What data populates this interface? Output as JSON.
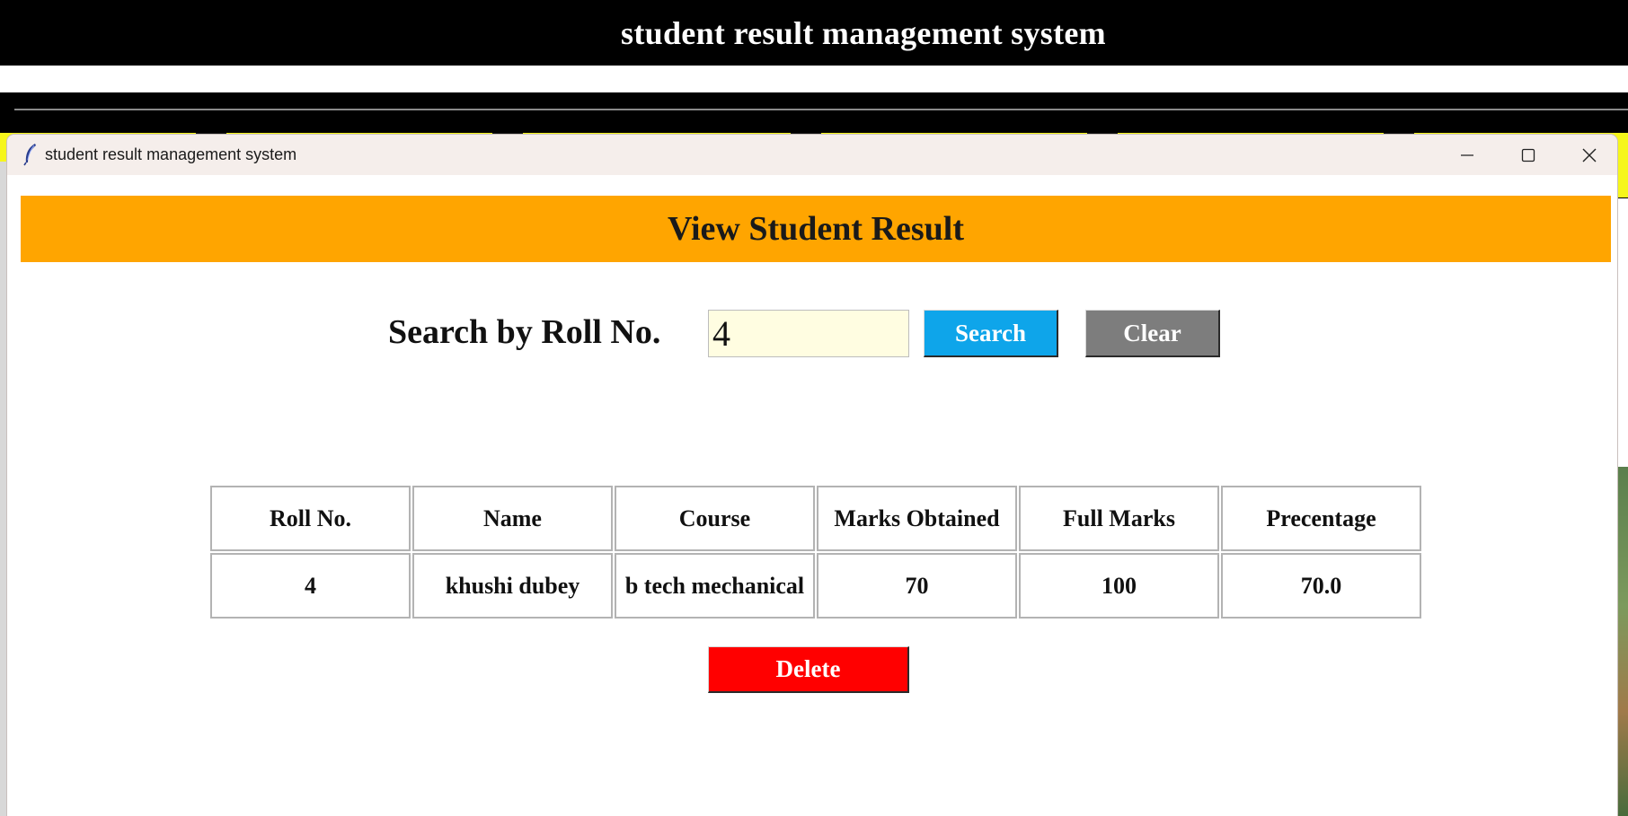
{
  "main_app": {
    "title": "student result management system"
  },
  "dialog": {
    "title": "student result management system",
    "icons": {
      "app": "feather-icon",
      "minimize": "minimize-icon",
      "maximize": "maximize-icon",
      "close": "close-icon"
    },
    "header": "View Student Result",
    "search": {
      "label": "Search by Roll No.",
      "value": "4",
      "search_button": "Search",
      "clear_button": "Clear"
    },
    "table": {
      "columns": [
        "Roll No.",
        "Name",
        "Course",
        "Marks Obtained",
        "Full Marks",
        "Precentage"
      ],
      "rows": [
        [
          "4",
          "khushi dubey",
          "b tech mechanical",
          "70",
          "100",
          "70.0"
        ]
      ]
    },
    "delete_button": "Delete"
  },
  "colors": {
    "banner": "#ffa500",
    "search_button": "#0ea5ea",
    "clear_button": "#7d7d7d",
    "delete_button": "#ff0000",
    "input_background": "#fffde1"
  }
}
